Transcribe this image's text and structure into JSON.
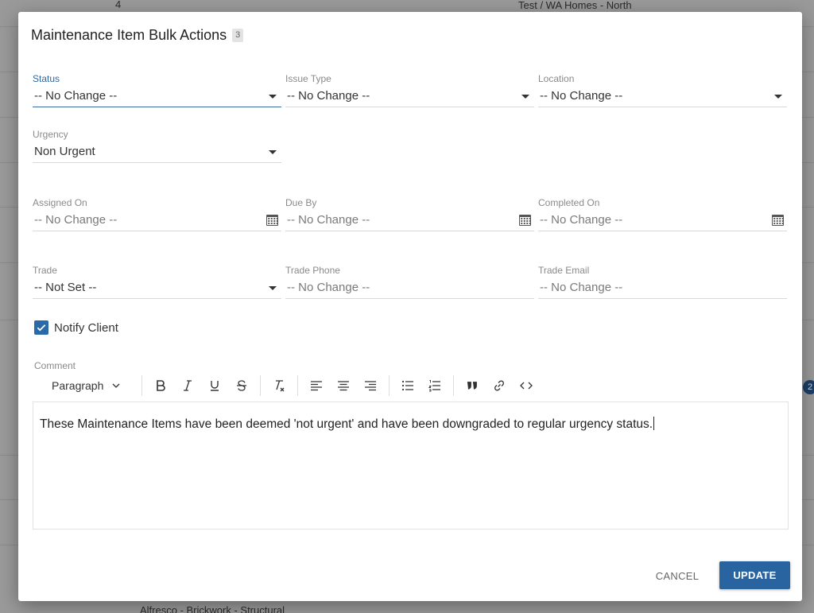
{
  "background": {
    "row_number": "4",
    "top_text": "Test / WA Homes - North",
    "bottom_text": "Alfresco - Brickwork - Structural",
    "badge_count": "2"
  },
  "modal": {
    "title": "Maintenance Item Bulk Actions",
    "selected_count": "3"
  },
  "fields": {
    "status": {
      "label": "Status",
      "value": "-- No Change --"
    },
    "issue_type": {
      "label": "Issue Type",
      "value": "-- No Change --"
    },
    "location": {
      "label": "Location",
      "value": "-- No Change --"
    },
    "urgency": {
      "label": "Urgency",
      "value": "Non Urgent"
    },
    "assigned_on": {
      "label": "Assigned On",
      "placeholder": "-- No Change --"
    },
    "due_by": {
      "label": "Due By",
      "placeholder": "-- No Change --"
    },
    "completed_on": {
      "label": "Completed On",
      "placeholder": "-- No Change --"
    },
    "trade": {
      "label": "Trade",
      "value": "-- Not Set --"
    },
    "trade_phone": {
      "label": "Trade Phone",
      "placeholder": "-- No Change --"
    },
    "trade_email": {
      "label": "Trade Email",
      "placeholder": "-- No Change --"
    }
  },
  "notify_client": {
    "label": "Notify Client",
    "checked": true
  },
  "comment": {
    "label": "Comment",
    "paragraph_style": "Paragraph",
    "text": "These Maintenance Items have been deemed 'not urgent' and have been downgraded to regular urgency status."
  },
  "actions": {
    "cancel_label": "CANCEL",
    "update_label": "UPDATE"
  },
  "colors": {
    "accent": "#2a64a0",
    "overlay": "#9a9a9a"
  }
}
